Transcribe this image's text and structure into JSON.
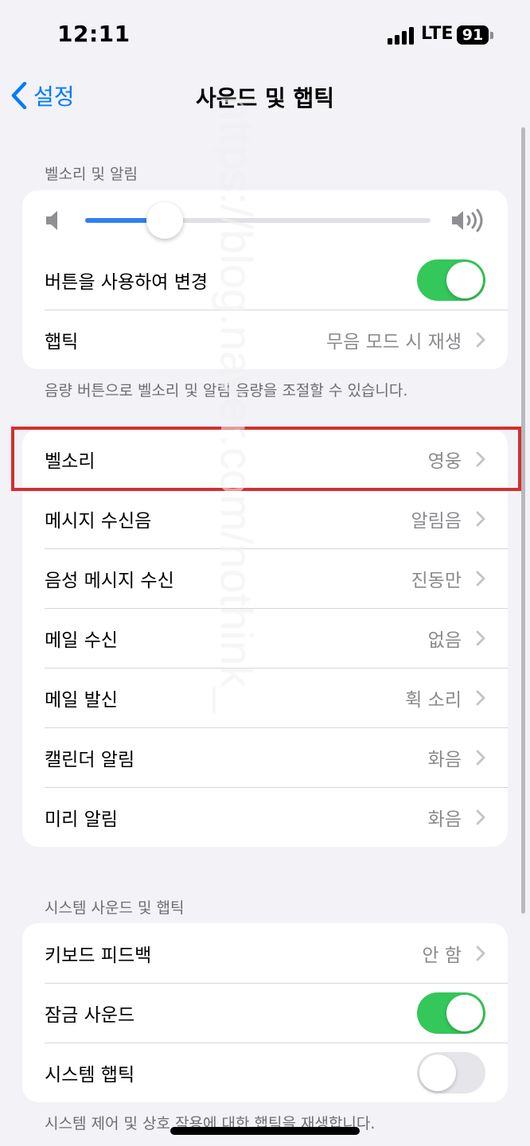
{
  "status": {
    "time": "12:11",
    "network": "LTE",
    "battery": "91"
  },
  "nav": {
    "back_label": "설정",
    "title": "사운드 및 햅틱"
  },
  "ringer_section": {
    "header": "벨소리 및 알림",
    "volume_level": 0.23,
    "change_with_buttons": {
      "label": "버튼을 사용하여 변경",
      "on": true
    },
    "haptics": {
      "label": "햅틱",
      "value": "무음 모드 시 재생"
    },
    "footer": "음량 버튼으로 벨소리 및 알림 음량을 조절할 수 있습니다."
  },
  "sounds": [
    {
      "label": "벨소리",
      "value": "영웅"
    },
    {
      "label": "메시지 수신음",
      "value": "알림음"
    },
    {
      "label": "음성 메시지 수신",
      "value": "진동만"
    },
    {
      "label": "메일 수신",
      "value": "없음"
    },
    {
      "label": "메일 발신",
      "value": "휙 소리"
    },
    {
      "label": "캘린더 알림",
      "value": "화음"
    },
    {
      "label": "미리 알림",
      "value": "화음"
    }
  ],
  "system_section": {
    "header": "시스템 사운드 및 햅틱",
    "keyboard_feedback": {
      "label": "키보드 피드백",
      "value": "안 함"
    },
    "lock_sound": {
      "label": "잠금 사운드",
      "on": true
    },
    "system_haptics": {
      "label": "시스템 햅틱",
      "on": false
    },
    "footer": "시스템 제어 및 상호 작용에 대한 햅틱을 재생합니다."
  },
  "watermark": "https://blog.naver.com/nothink_",
  "colors": {
    "accent": "#007aff",
    "toggle_on": "#34c759",
    "highlight": "#d32f2f"
  }
}
